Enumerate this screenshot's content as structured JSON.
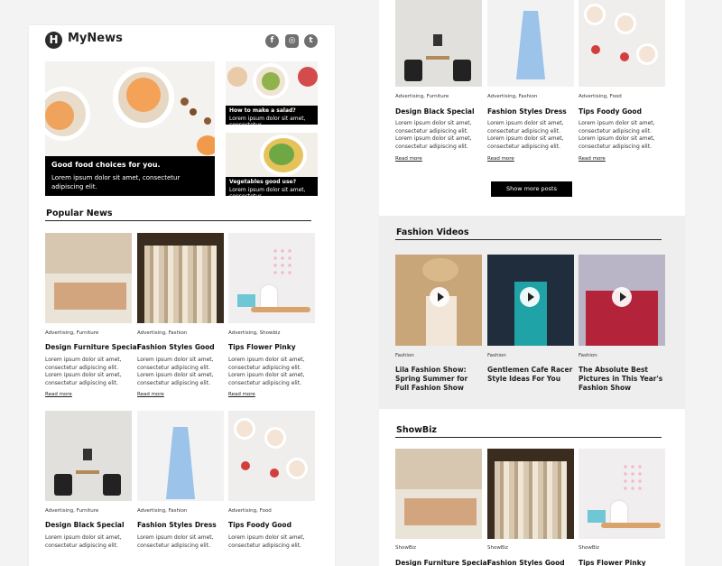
{
  "brand": {
    "name": "MyNews",
    "logo_letter": "H"
  },
  "social": [
    "f",
    "◎",
    "t"
  ],
  "hero": {
    "main": {
      "title": "Good food choices for you.",
      "text": "Lorem ipsum dolor sit amet, consectetur adipiscing elit."
    },
    "side": [
      {
        "title": "How to make a salad?",
        "text": "Lorem ipsum dolor sit amet, consectetur"
      },
      {
        "title": "Vegetables good use?",
        "text": "Lorem ipsum dolor sit amet, consectetur"
      }
    ]
  },
  "popular": {
    "heading": "Popular News",
    "row1": [
      {
        "category": "Advertising, Furniture",
        "title": "Design Furniture Special",
        "desc": "Lorem ipsum dolor sit amet, consectetur adipiscing elit. Lorem ipsum dolor sit amet, consectetur adipiscing elit.",
        "link": "Read more"
      },
      {
        "category": "Advertising, Fashion",
        "title": "Fashion Styles Good",
        "desc": "Lorem ipsum dolor sit amet, consectetur adipiscing elit. Lorem ipsum dolor sit amet, consectetur adipiscing elit.",
        "link": "Read more"
      },
      {
        "category": "Advertising, Showbiz",
        "title": "Tips Flower Pinky",
        "desc": "Lorem ipsum dolor sit amet, consectetur adipiscing elit. Lorem ipsum dolor sit amet, consectetur adipiscing elit.",
        "link": "Read more"
      }
    ],
    "row2": [
      {
        "category": "Advertising, Furniture",
        "title": "Design Black Special",
        "desc": "Lorem ipsum dolor sit amet, consectetur adipiscing elit."
      },
      {
        "category": "Advertising, Fashion",
        "title": "Fashion Styles Dress",
        "desc": "Lorem ipsum dolor sit amet, consectetur adipiscing elit."
      },
      {
        "category": "Advertising, Food",
        "title": "Tips Foody Good",
        "desc": "Lorem ipsum dolor sit amet, consectetur adipiscing elit."
      }
    ]
  },
  "right_top": {
    "cards": [
      {
        "category": "Advertising, Furniture",
        "title": "Design Black Special",
        "desc": "Lorem ipsum dolor sit amet, consectetur adipiscing elit. Lorem ipsum dolor sit amet, consectetur adipiscing elit.",
        "link": "Read more"
      },
      {
        "category": "Advertising, Fashion",
        "title": "Fashion Styles Dress",
        "desc": "Lorem ipsum dolor sit amet, consectetur adipiscing elit. Lorem ipsum dolor sit amet, consectetur adipiscing elit.",
        "link": "Read more"
      },
      {
        "category": "Advertising, Food",
        "title": "Tips Foody Good",
        "desc": "Lorem ipsum dolor sit amet, consectetur adipiscing elit. Lorem ipsum dolor sit amet, consectetur adipiscing elit.",
        "link": "Read more"
      }
    ],
    "button": "Show more posts"
  },
  "videos": {
    "heading": "Fashion Videos",
    "items": [
      {
        "category": "Fashion",
        "title": "Lila Fashion Show: Spring Summer for Full Fashion Show"
      },
      {
        "category": "Fashion",
        "title": "Gentlemen Cafe Racer Style Ideas For You"
      },
      {
        "category": "Fashion",
        "title": "The Absolute Best Pictures in This Year's Fashion Show"
      }
    ]
  },
  "showbiz": {
    "heading": "ShowBiz",
    "items": [
      {
        "category": "ShowBiz",
        "title": "Design Furniture Special"
      },
      {
        "category": "ShowBiz",
        "title": "Fashion Styles Good"
      },
      {
        "category": "ShowBiz",
        "title": "Tips Flower Pinky"
      }
    ]
  }
}
